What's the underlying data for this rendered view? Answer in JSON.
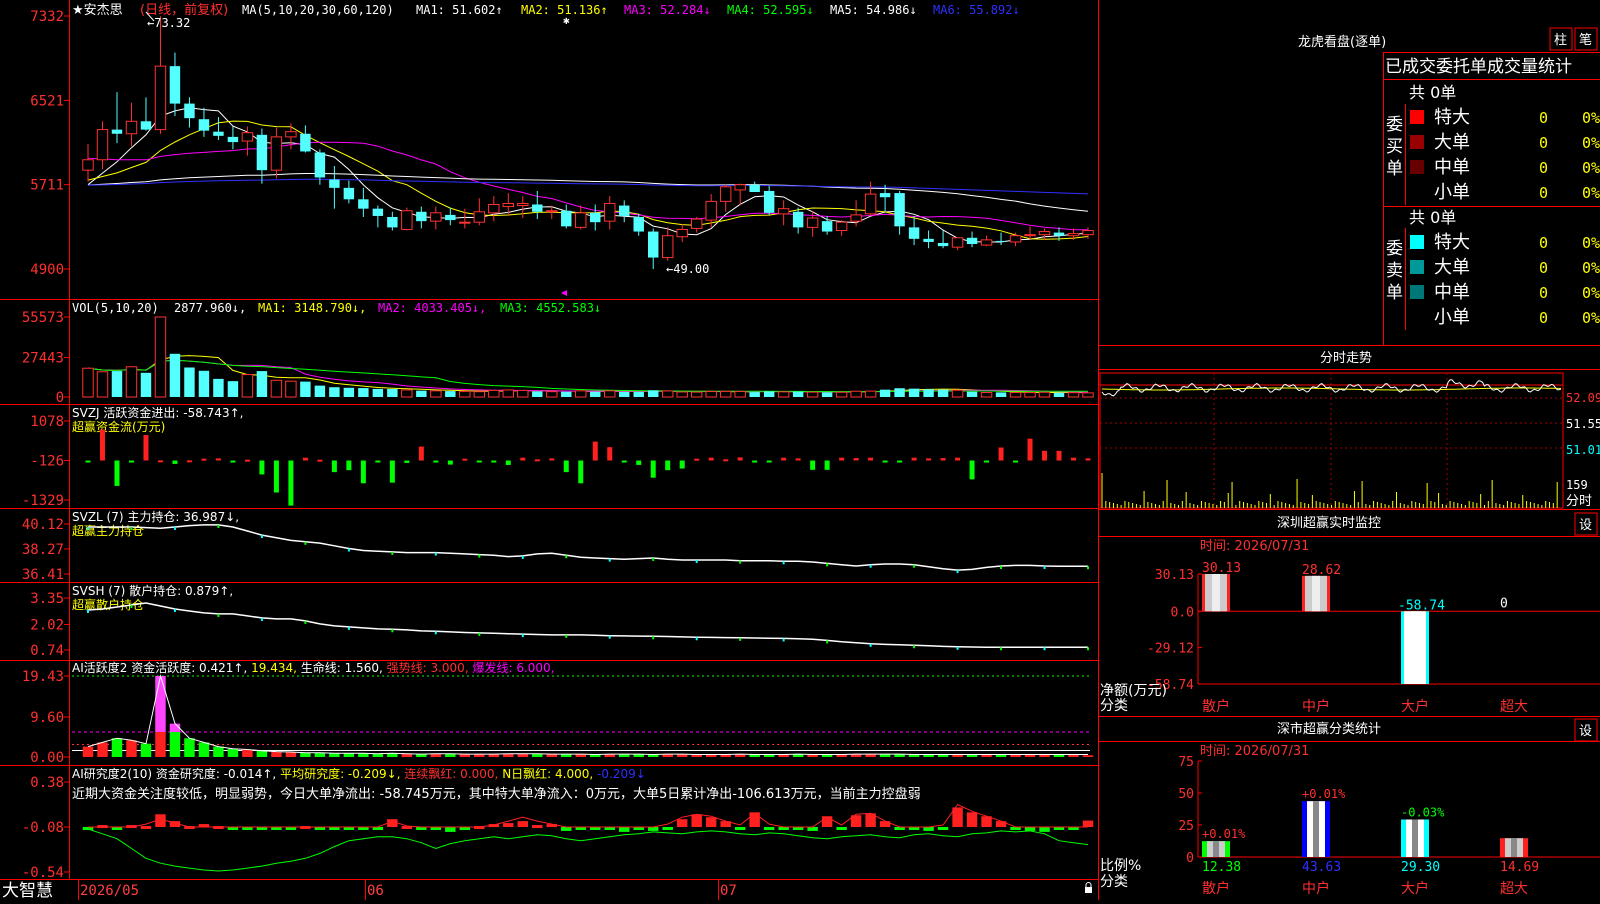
{
  "header": {
    "stock_name": "★安杰思",
    "period": "(日线，前复权)",
    "ma_params": "MA(5,10,20,30,60,120)",
    "ma": [
      {
        "label": "MA1:",
        "value": "51.602",
        "arrow": "↑",
        "color": "#ffffff"
      },
      {
        "label": "MA2:",
        "value": "51.136",
        "arrow": "↑",
        "color": "#ffff00"
      },
      {
        "label": "MA3:",
        "value": "52.284",
        "arrow": "↓",
        "color": "#ff00ff"
      },
      {
        "label": "MA4:",
        "value": "52.595",
        "arrow": "↓",
        "color": "#00ff00"
      },
      {
        "label": "MA5:",
        "value": "54.986",
        "arrow": "↓",
        "color": "#ffffff"
      },
      {
        "label": "MA6:",
        "value": "55.892",
        "arrow": "↓",
        "color": "#3030ff"
      }
    ]
  },
  "main_chart": {
    "y_ticks": [
      "7332",
      "6521",
      "5711",
      "4900"
    ],
    "high_label": "73.32",
    "low_label": "49.00"
  },
  "vol_panel": {
    "title": "VOL(5,10,20)",
    "value": "2877.960↓,",
    "ma": [
      {
        "label": "MA1:",
        "value": "3148.790↓,",
        "color": "#ffff00"
      },
      {
        "label": "MA2:",
        "value": "4033.405↓,",
        "color": "#ff00ff"
      },
      {
        "label": "MA3:",
        "value": "4552.583↓",
        "color": "#00ff00"
      }
    ],
    "y_ticks": [
      "55573",
      "27443",
      "0"
    ]
  },
  "svzj_panel": {
    "title": "SVZJ  活跃资金进出: -58.743↑,",
    "subtitle": "超赢资金流(万元)",
    "y_ticks": [
      "1078",
      "-126",
      "-1329"
    ]
  },
  "svzl_panel": {
    "title": "SVZL (7) 主力持仓: 36.987↓,",
    "subtitle": "超赢主力持仓",
    "y_ticks": [
      "40.12",
      "38.27",
      "36.41"
    ]
  },
  "svsh_panel": {
    "title": "SVSH (7) 散户持仓: 0.879↑,",
    "subtitle": "超赢散户持仓",
    "y_ticks": [
      "3.35",
      "2.02",
      "0.74"
    ]
  },
  "ai_active_panel": {
    "title_a": "AI活跃度2 资金活跃度: 0.421↑,",
    "title_b": "19.434,",
    "title_c": "生命线: 1.560,",
    "title_d": "强势线: 3.000,",
    "title_e": "爆发线: 6.000,",
    "y_ticks": [
      "19.43",
      "9.60",
      "0.00"
    ]
  },
  "ai_research_panel": {
    "title_a": "AI研究度2(10) 资金研究度: -0.014↑,",
    "title_b": "平均研究度: -0.209↓,",
    "title_c": "连续飘红: 0.000,",
    "title_d": "N日飘红: 4.000,",
    "title_e": "-0.209↓",
    "comment": "近期大资金关注度较低，明显弱势，今日大单净流出: -58.745万元，其中特大单净流入：0万元，大单5日累计净出-106.613万元，当前主力控盘弱",
    "y_ticks": [
      "0.38",
      "-0.08",
      "-0.54"
    ]
  },
  "x_axis": {
    "brand": "大智慧",
    "labels": [
      "2026/05",
      "06",
      "07"
    ]
  },
  "right_panel": {
    "longhu": {
      "title": "龙虎看盘(逐单)",
      "btn_zhu": "柱",
      "btn_bi": "笔",
      "header": "已成交委托单成交量统计",
      "buy": {
        "side_label": "委买单",
        "total": "共 0单",
        "rows": [
          {
            "label": "特大",
            "value": "0",
            "pct": "0%",
            "color": "#ff0000"
          },
          {
            "label": "大单",
            "value": "0",
            "pct": "0%",
            "color": "#990000"
          },
          {
            "label": "中单",
            "value": "0",
            "pct": "0%",
            "color": "#660000"
          },
          {
            "label": "小单",
            "value": "0",
            "pct": "0%",
            "color": "#000000"
          }
        ]
      },
      "sell": {
        "side_label": "委卖单",
        "total": "共 0单",
        "rows": [
          {
            "label": "特大",
            "value": "0",
            "pct": "0%",
            "color": "#00ffff"
          },
          {
            "label": "大单",
            "value": "0",
            "pct": "0%",
            "color": "#009999"
          },
          {
            "label": "中单",
            "value": "0",
            "pct": "0%",
            "color": "#007777"
          },
          {
            "label": "小单",
            "value": "0",
            "pct": "0%",
            "color": "#000000"
          }
        ]
      }
    },
    "intraday": {
      "title": "分时走势",
      "y_ticks": [
        "52.09",
        "51.55",
        "51.01"
      ],
      "vol_label": "159",
      "time_label": "分时"
    },
    "sz_monitor": {
      "title": "深圳超赢实时监控",
      "btn": "设",
      "date": "时间: 2026/07/31",
      "y_ticks": [
        "30.13",
        "0.0",
        "-29.12",
        "-58.74"
      ],
      "y_title": "净额(万元)",
      "x_title": "分类",
      "categories": [
        "散户",
        "中户",
        "大户",
        "超大"
      ],
      "bar_labels": [
        "30.13",
        "28.62",
        "-58.74",
        "0"
      ],
      "values": [
        30.13,
        28.62,
        -58.74,
        0
      ]
    },
    "sz_stats": {
      "title": "深市超赢分类统计",
      "btn": "设",
      "date": "时间: 2026/07/31",
      "y_ticks": [
        "75",
        "50",
        "25",
        "0"
      ],
      "y_title": "比例%",
      "x_title": "分类",
      "categories": [
        "散户",
        "中户",
        "大户",
        "超大"
      ],
      "values": [
        12.38,
        43.63,
        29.3,
        14.69
      ],
      "value_labels": [
        "12.38",
        "43.63",
        "29.30",
        "14.69"
      ],
      "change_labels": [
        "+0.01%",
        "+0.01%",
        "-0.03%",
        ""
      ]
    }
  },
  "chart_data": [
    {
      "type": "candlestick",
      "title": "★安杰思 (日线，前复权)",
      "ylim": [
        49.0,
        73.32
      ],
      "y_ticks": [
        73.32,
        65.21,
        57.11,
        49.0
      ],
      "candles": [
        [
          58.5,
          61.0,
          57.4,
          59.5
        ],
        [
          59.5,
          63.2,
          58.6,
          62.4
        ],
        [
          62.4,
          66.0,
          61.1,
          62.0
        ],
        [
          62.0,
          65.0,
          60.8,
          63.2
        ],
        [
          63.2,
          65.5,
          62.3,
          62.4
        ],
        [
          62.4,
          73.3,
          62.0,
          68.5
        ],
        [
          68.5,
          69.8,
          63.7,
          64.9
        ],
        [
          64.9,
          65.5,
          62.6,
          63.5
        ],
        [
          63.4,
          64.5,
          61.7,
          62.3
        ],
        [
          62.2,
          63.6,
          61.4,
          61.8
        ],
        [
          61.7,
          62.7,
          60.5,
          61.2
        ],
        [
          61.3,
          62.7,
          59.9,
          62.1
        ],
        [
          61.9,
          62.5,
          57.2,
          58.5
        ],
        [
          58.5,
          62.6,
          57.7,
          61.7
        ],
        [
          61.7,
          63.0,
          60.5,
          62.2
        ],
        [
          62.0,
          62.8,
          60.2,
          60.3
        ],
        [
          60.2,
          60.5,
          57.1,
          57.8
        ],
        [
          57.6,
          58.9,
          54.8,
          56.8
        ],
        [
          56.8,
          57.5,
          55.3,
          55.7
        ],
        [
          55.7,
          56.8,
          54.0,
          54.8
        ],
        [
          54.8,
          55.1,
          53.0,
          54.1
        ],
        [
          54.0,
          54.5,
          52.7,
          53.0
        ],
        [
          52.8,
          54.9,
          52.7,
          54.6
        ],
        [
          54.5,
          55.0,
          52.9,
          53.6
        ],
        [
          53.6,
          55.0,
          52.8,
          54.4
        ],
        [
          54.2,
          54.9,
          53.2,
          53.7
        ],
        [
          53.5,
          54.8,
          52.9,
          53.5
        ],
        [
          53.5,
          55.8,
          53.2,
          54.5
        ],
        [
          54.4,
          56.0,
          53.6,
          55.2
        ],
        [
          55.0,
          56.3,
          54.1,
          55.3
        ],
        [
          55.1,
          56.0,
          53.9,
          55.3
        ],
        [
          55.2,
          56.5,
          53.8,
          54.5
        ],
        [
          54.5,
          55.1,
          53.8,
          54.6
        ],
        [
          54.6,
          55.2,
          52.9,
          53.1
        ],
        [
          53.0,
          55.1,
          52.8,
          54.4
        ],
        [
          54.4,
          55.2,
          52.7,
          53.5
        ],
        [
          53.6,
          56.0,
          52.8,
          55.3
        ],
        [
          55.1,
          55.6,
          53.5,
          54.1
        ],
        [
          54.0,
          54.3,
          52.2,
          52.6
        ],
        [
          52.6,
          52.9,
          49.0,
          50.1
        ],
        [
          50.1,
          53.0,
          49.8,
          52.2
        ],
        [
          52.1,
          53.3,
          51.6,
          52.8
        ],
        [
          52.9,
          54.0,
          52.5,
          53.8
        ],
        [
          53.7,
          56.2,
          53.0,
          55.5
        ],
        [
          55.5,
          57.1,
          54.5,
          56.9
        ],
        [
          56.6,
          57.2,
          55.1,
          57.1
        ],
        [
          57.1,
          57.4,
          56.5,
          56.4
        ],
        [
          56.5,
          57.0,
          54.2,
          54.4
        ],
        [
          54.3,
          55.6,
          53.2,
          54.8
        ],
        [
          54.5,
          54.9,
          52.4,
          53.0
        ],
        [
          53.0,
          54.6,
          52.1,
          53.9
        ],
        [
          53.6,
          54.1,
          52.3,
          52.6
        ],
        [
          52.7,
          53.7,
          52.2,
          53.5
        ],
        [
          53.6,
          55.6,
          53.1,
          54.2
        ],
        [
          54.3,
          57.4,
          54.1,
          56.2
        ],
        [
          56.3,
          57.1,
          54.5,
          55.9
        ],
        [
          56.3,
          56.5,
          52.3,
          53.1
        ],
        [
          53.0,
          54.1,
          51.3,
          51.9
        ],
        [
          51.9,
          52.7,
          51.0,
          51.6
        ],
        [
          51.5,
          52.7,
          51.0,
          51.2
        ],
        [
          51.1,
          52.0,
          50.8,
          52.0
        ],
        [
          52.0,
          52.6,
          51.1,
          51.4
        ],
        [
          51.3,
          52.2,
          51.2,
          51.8
        ],
        [
          51.7,
          52.5,
          51.3,
          51.6
        ],
        [
          51.6,
          52.5,
          51.2,
          52.2
        ],
        [
          52.2,
          53.1,
          51.8,
          52.3
        ],
        [
          52.3,
          52.9,
          51.8,
          52.6
        ],
        [
          52.5,
          53.0,
          51.7,
          52.2
        ],
        [
          52.2,
          52.9,
          51.8,
          52.4
        ],
        [
          52.3,
          53.0,
          51.9,
          52.7
        ]
      ],
      "x_labels": [
        "2026/05",
        "06",
        "07"
      ]
    },
    {
      "type": "bar",
      "title": "VOL(5,10,20)",
      "ylim": [
        0,
        55573
      ],
      "values": [
        20000,
        17500,
        18000,
        21000,
        16800,
        55573,
        30000,
        20500,
        18200,
        12600,
        11000,
        15600,
        18000,
        11600,
        11000,
        10700,
        7900,
        6800,
        6400,
        6200,
        5600,
        5600,
        4900,
        4400,
        4300,
        4100,
        3900,
        3700,
        4600,
        4900,
        4600,
        3900,
        3700,
        3700,
        4300,
        3700,
        4300,
        3600,
        3600,
        4600,
        4200,
        3500,
        3400,
        3800,
        3900,
        3800,
        3400,
        3900,
        3600,
        3800,
        3400,
        3200,
        3300,
        4000,
        4100,
        5100,
        6100,
        5800,
        5400,
        5100,
        4700,
        3700,
        3100,
        3200,
        3100,
        3100,
        3300,
        3000,
        3000,
        2878
      ]
    },
    {
      "type": "bar",
      "title": "SVZJ 活跃资金进出",
      "ylim": [
        -1329,
        1078
      ],
      "values": [
        -150,
        820,
        -900,
        -150,
        650,
        -120,
        -230,
        -120,
        -70,
        -60,
        -130,
        -100,
        -550,
        -1100,
        -1500,
        -40,
        -100,
        -480,
        -420,
        -820,
        -150,
        -800,
        -200,
        300,
        -180,
        -250,
        -70,
        -160,
        -150,
        -260,
        -40,
        -90,
        -60,
        -480,
        -820,
        450,
        280,
        -170,
        -260,
        -650,
        -420,
        -370,
        -70,
        -40,
        -90,
        -30,
        -140,
        -140,
        -40,
        -60,
        -410,
        -410,
        -40,
        -50,
        -40,
        -180,
        -160,
        -40,
        -60,
        -50,
        -40,
        -700,
        -160,
        270,
        -150,
        540,
        170,
        170,
        -40,
        -58.7
      ]
    },
    {
      "type": "line",
      "title": "SVZL (7) 主力持仓",
      "ylim": [
        36.41,
        40.12
      ],
      "values": [
        39.9,
        39.9,
        39.9,
        39.9,
        39.85,
        39.8,
        39.9,
        40.0,
        40.05,
        40.05,
        39.9,
        39.6,
        39.3,
        39.1,
        38.9,
        38.8,
        38.7,
        38.5,
        38.3,
        38.15,
        38.1,
        38.05,
        38.0,
        38.0,
        38.0,
        37.95,
        37.9,
        37.85,
        37.8,
        37.7,
        37.75,
        37.9,
        37.95,
        37.8,
        37.65,
        37.6,
        37.55,
        37.5,
        37.55,
        37.6,
        37.5,
        37.45,
        37.45,
        37.45,
        37.45,
        37.4,
        37.4,
        37.4,
        37.35,
        37.35,
        37.3,
        37.2,
        37.1,
        37.0,
        37.1,
        37.15,
        37.15,
        37.1,
        36.95,
        36.8,
        36.7,
        36.75,
        36.9,
        37.0,
        37.05,
        37.05,
        37.0,
        36.99,
        36.99,
        36.987
      ]
    },
    {
      "type": "line",
      "title": "SVSH (7) 散户持仓",
      "ylim": [
        0.74,
        3.35
      ],
      "values": [
        2.75,
        2.8,
        2.9,
        3.0,
        3.1,
        2.95,
        2.8,
        2.7,
        2.6,
        2.55,
        2.55,
        2.45,
        2.35,
        2.3,
        2.3,
        2.2,
        2.05,
        1.95,
        1.9,
        1.85,
        1.8,
        1.78,
        1.75,
        1.7,
        1.68,
        1.65,
        1.62,
        1.6,
        1.58,
        1.56,
        1.54,
        1.52,
        1.5,
        1.5,
        1.5,
        1.48,
        1.46,
        1.45,
        1.44,
        1.43,
        1.42,
        1.4,
        1.38,
        1.37,
        1.36,
        1.35,
        1.34,
        1.33,
        1.32,
        1.3,
        1.28,
        1.22,
        1.15,
        1.1,
        1.05,
        1.02,
        1.0,
        0.98,
        0.95,
        0.92,
        0.9,
        0.89,
        0.88,
        0.88,
        0.88,
        0.88,
        0.88,
        0.88,
        0.88,
        0.879
      ]
    },
    {
      "type": "bar",
      "title": "AI活跃度2 资金活跃度",
      "ylim": [
        0,
        19.43
      ],
      "values": [
        2.5,
        3.5,
        4.5,
        4.0,
        3.2,
        19.43,
        8.0,
        4.5,
        3.5,
        2.5,
        2.0,
        1.8,
        1.5,
        1.3,
        1.2,
        1.0,
        1.0,
        0.9,
        0.9,
        0.9,
        0.8,
        0.9,
        0.8,
        0.7,
        0.8,
        0.8,
        0.7,
        0.7,
        0.7,
        0.8,
        0.8,
        0.8,
        0.7,
        0.7,
        0.7,
        0.6,
        0.7,
        0.7,
        0.7,
        0.6,
        0.7,
        0.7,
        0.6,
        0.6,
        0.6,
        0.7,
        0.6,
        0.6,
        0.6,
        0.7,
        0.6,
        0.6,
        0.6,
        0.7,
        0.7,
        0.7,
        0.7,
        0.6,
        0.6,
        0.6,
        0.6,
        0.6,
        0.6,
        0.6,
        0.6,
        0.6,
        0.6,
        0.5,
        0.5,
        0.421
      ]
    },
    {
      "type": "bar",
      "title": "AI研究度2(10) 资金研究度",
      "ylim": [
        -0.54,
        0.38
      ],
      "values": [
        -0.09,
        -0.06,
        -0.09,
        -0.06,
        -0.07,
        0.05,
        -0.02,
        -0.07,
        -0.05,
        -0.07,
        -0.08,
        -0.09,
        -0.08,
        -0.09,
        -0.08,
        -0.07,
        -0.09,
        -0.08,
        -0.08,
        -0.09,
        -0.08,
        0.0,
        -0.07,
        -0.1,
        -0.08,
        -0.13,
        -0.1,
        -0.07,
        -0.05,
        -0.04,
        -0.02,
        -0.06,
        -0.05,
        -0.12,
        -0.08,
        -0.1,
        -0.11,
        -0.13,
        -0.11,
        -0.12,
        -0.08,
        0.0,
        0.05,
        0.02,
        -0.02,
        -0.09,
        0.07,
        -0.09,
        -0.1,
        -0.11,
        -0.12,
        0.03,
        -0.09,
        0.04,
        0.06,
        -0.02,
        -0.11,
        -0.11,
        -0.12,
        -0.08,
        0.12,
        0.07,
        0.03,
        -0.02,
        -0.1,
        -0.12,
        -0.13,
        -0.09,
        -0.08,
        -0.014
      ]
    }
  ]
}
